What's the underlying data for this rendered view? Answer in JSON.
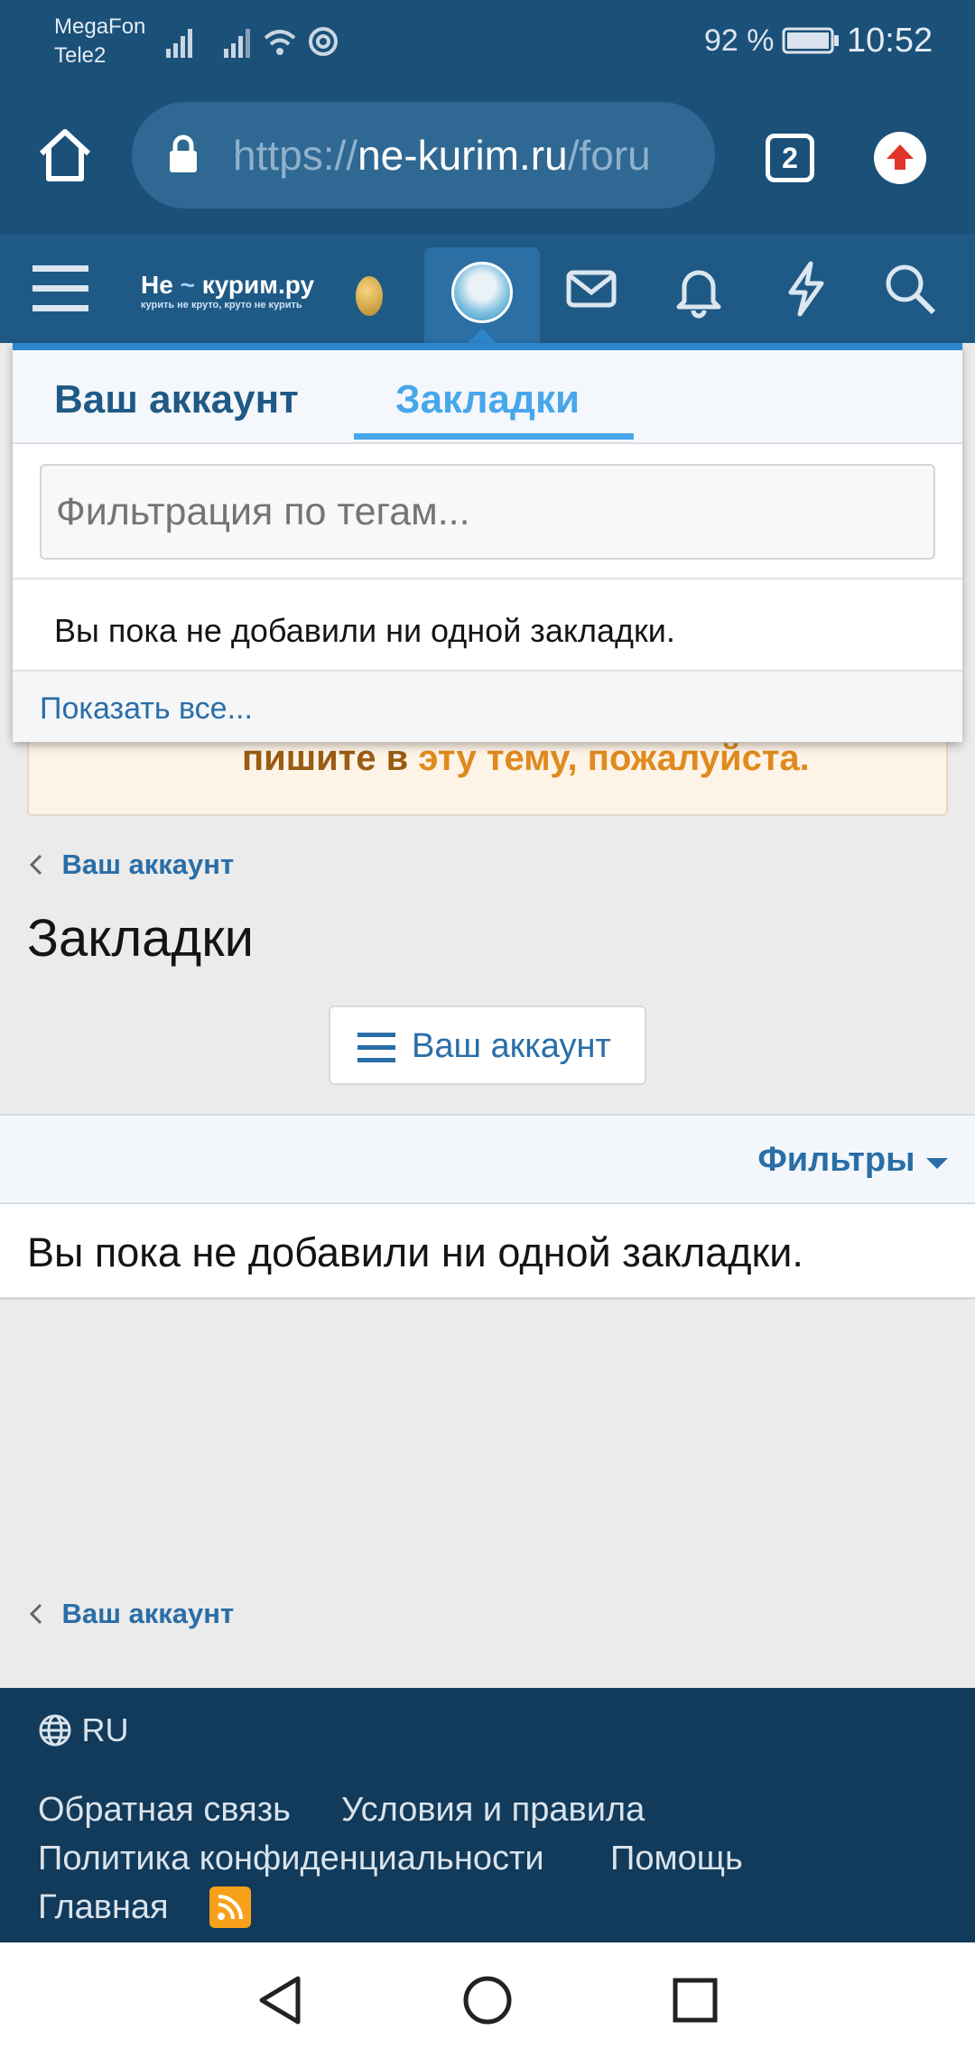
{
  "status_bar": {
    "carrier1": "MegaFon",
    "carrier2": "Tele2",
    "battery": "92 %",
    "time": "10:52"
  },
  "browser": {
    "url_prefix": "https://",
    "url_host": "ne-kurim.ru",
    "url_suffix": "/foru",
    "tab_count": "2"
  },
  "site": {
    "logo_title": "Не",
    "logo_title2": "курим.ру",
    "logo_tagline": "курить не круто, круто не курить"
  },
  "dropdown": {
    "tab_account": "Ваш аккаунт",
    "tab_bookmarks": "Закладки",
    "filter_placeholder": "Фильтрация по тегам...",
    "empty_message": "Вы пока не добавили ни одной закладки.",
    "show_all": "Показать все..."
  },
  "notice": {
    "text_plain": "пишите в ",
    "text_link": "эту тему, пожалуйста."
  },
  "page": {
    "breadcrumb": "Ваш аккаунт",
    "title": "Закладки",
    "account_button": "Ваш аккаунт",
    "filters": "Фильтры",
    "empty_message": "Вы пока не добавили ни одной закладки.",
    "breadcrumb_bottom": "Ваш аккаунт"
  },
  "footer": {
    "language": "RU",
    "links": [
      "Обратная связь",
      "Условия и правила",
      "Политика конфиденциальности",
      "Помощь",
      "Главная"
    ]
  },
  "colors": {
    "header_bg": "#1b5079",
    "nav_bg": "#1f5a86",
    "link": "#2a6ea7",
    "accent": "#47a7eb",
    "footer_bg": "#123a5a",
    "notice_link": "#e08a1e"
  }
}
